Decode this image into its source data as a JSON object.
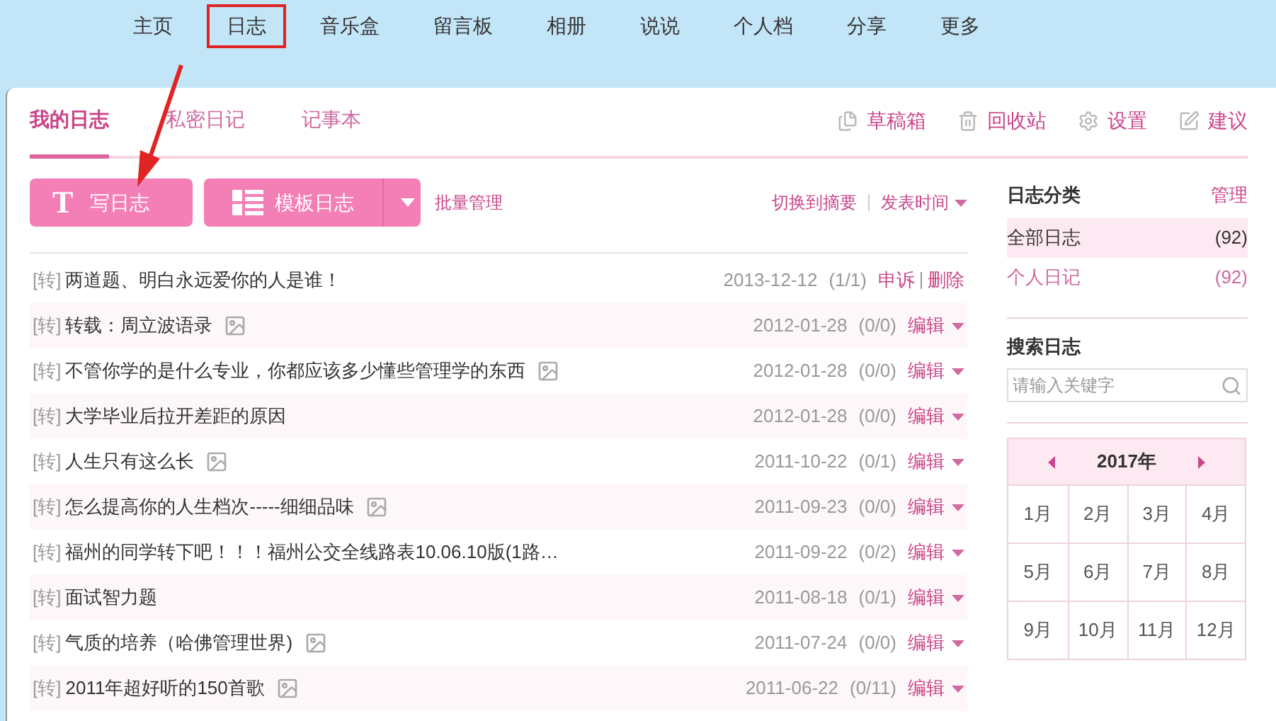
{
  "nav": [
    {
      "label": "主页",
      "selected": false
    },
    {
      "label": "日志",
      "selected": true
    },
    {
      "label": "音乐盒",
      "selected": false
    },
    {
      "label": "留言板",
      "selected": false
    },
    {
      "label": "相册",
      "selected": false
    },
    {
      "label": "说说",
      "selected": false
    },
    {
      "label": "个人档",
      "selected": false
    },
    {
      "label": "分享",
      "selected": false
    },
    {
      "label": "更多",
      "selected": false
    }
  ],
  "tabs": [
    {
      "label": "我的日志",
      "selected": true
    },
    {
      "label": "私密日记",
      "selected": false
    },
    {
      "label": "记事本",
      "selected": false
    }
  ],
  "tools": [
    {
      "label": "草稿箱",
      "kind": "drafts"
    },
    {
      "label": "回收站",
      "kind": "trash"
    },
    {
      "label": "设置",
      "kind": "settings"
    },
    {
      "label": "建议",
      "kind": "suggest"
    }
  ],
  "write_button": {
    "icon": "T",
    "label": "写日志"
  },
  "template_button": {
    "label": "模板日志"
  },
  "batch_link": "批量管理",
  "view_links": {
    "summary": "切换到摘要",
    "sort": "发表时间"
  },
  "posts": [
    {
      "tag": "[转]",
      "title": "两道题、明白永远爱你的人是谁！",
      "has_image": false,
      "date": "2013-12-12",
      "count": "(1/1)",
      "kind": "reported",
      "actions": [
        "申诉",
        "删除"
      ]
    },
    {
      "tag": "[转]",
      "title": "转载：周立波语录",
      "has_image": true,
      "date": "2012-01-28",
      "count": "(0/0)",
      "kind": "editable",
      "actions": [
        "编辑"
      ]
    },
    {
      "tag": "[转]",
      "title": "不管你学的是什么专业，你都应该多少懂些管理学的东西",
      "has_image": true,
      "date": "2012-01-28",
      "count": "(0/0)",
      "kind": "editable",
      "actions": [
        "编辑"
      ]
    },
    {
      "tag": "[转]",
      "title": "大学毕业后拉开差距的原因",
      "has_image": false,
      "date": "2012-01-28",
      "count": "(0/0)",
      "kind": "editable",
      "actions": [
        "编辑"
      ]
    },
    {
      "tag": "[转]",
      "title": "人生只有这么长",
      "has_image": true,
      "date": "2011-10-22",
      "count": "(0/1)",
      "kind": "editable",
      "actions": [
        "编辑"
      ]
    },
    {
      "tag": "[转]",
      "title": "怎么提高你的人生档次-----细细品味",
      "has_image": true,
      "date": "2011-09-23",
      "count": "(0/0)",
      "kind": "editable",
      "actions": [
        "编辑"
      ]
    },
    {
      "tag": "[转]",
      "title": "福州的同学转下吧！！！福州公交全线路表10.06.10版(1路…",
      "has_image": false,
      "date": "2011-09-22",
      "count": "(0/2)",
      "kind": "editable",
      "actions": [
        "编辑"
      ]
    },
    {
      "tag": "[转]",
      "title": "面试智力题",
      "has_image": false,
      "date": "2011-08-18",
      "count": "(0/1)",
      "kind": "editable",
      "actions": [
        "编辑"
      ]
    },
    {
      "tag": "[转]",
      "title": "气质的培养（哈佛管理世界)",
      "has_image": true,
      "date": "2011-07-24",
      "count": "(0/0)",
      "kind": "editable",
      "actions": [
        "编辑"
      ]
    },
    {
      "tag": "[转]",
      "title": "2011年超好听的150首歌",
      "has_image": true,
      "date": "2011-06-22",
      "count": "(0/11)",
      "kind": "editable",
      "actions": [
        "编辑"
      ]
    }
  ],
  "categories": {
    "title": "日志分类",
    "manage": "管理",
    "items": [
      {
        "label": "全部日志",
        "count": "(92)",
        "selected": true
      },
      {
        "label": "个人日记",
        "count": "(92)",
        "selected": false
      }
    ]
  },
  "search": {
    "title": "搜索日志",
    "placeholder": "请输入关键字"
  },
  "calendar": {
    "year": "2017年",
    "months": [
      "1月",
      "2月",
      "3月",
      "4月",
      "5月",
      "6月",
      "7月",
      "8月",
      "9月",
      "10月",
      "11月",
      "12月"
    ]
  }
}
